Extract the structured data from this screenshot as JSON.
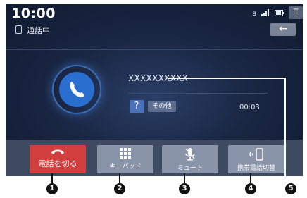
{
  "status_bar": {
    "time": "10:00",
    "icons": [
      "bluetooth-icon",
      "signal-icon",
      "battery-icon"
    ],
    "menu_icon": "menu-icon"
  },
  "call_bar": {
    "status_text": "通話中",
    "back_icon": "←"
  },
  "caller": {
    "number": "XXXXXXXXXX",
    "help_label": "?",
    "other_label": "その他",
    "duration": "00:03"
  },
  "actions": [
    {
      "label": "電話を切る",
      "icon": "hang-up-icon",
      "color": "#d23f3f"
    },
    {
      "label": "キーパッド",
      "icon": "keypad-icon"
    },
    {
      "label": "ミュート",
      "icon": "microphone-icon"
    },
    {
      "label": "携帯電話切替",
      "icon": "phone-switch-icon"
    }
  ],
  "callouts": [
    "1",
    "2",
    "3",
    "4",
    "5"
  ],
  "colors": {
    "accent_blue": "#2a6ed0",
    "hangup_red": "#d23f3f",
    "button_gray": "#8a94a8"
  }
}
